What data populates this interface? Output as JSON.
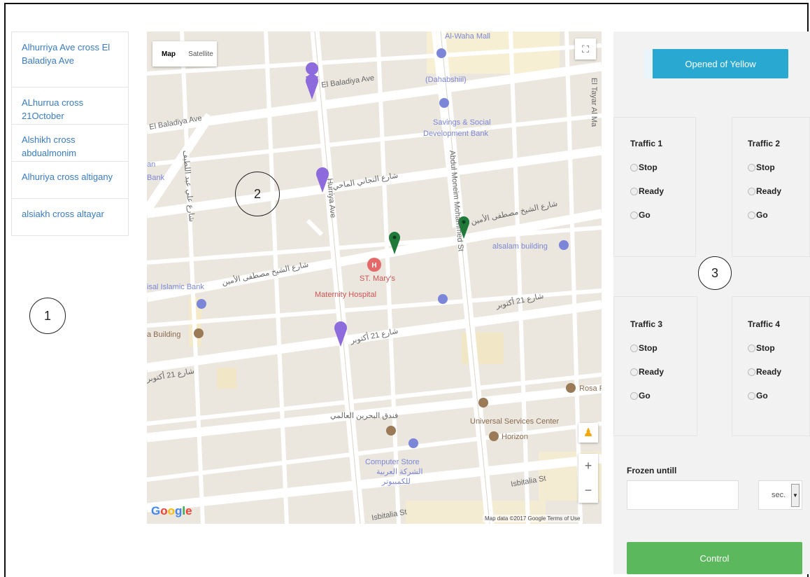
{
  "intersections": [
    {
      "label": "Alhurriya Ave cross El Baladiya Ave"
    },
    {
      "label": "ALhurrua cross 21October"
    },
    {
      "label": "Alshikh cross abdualmonim"
    },
    {
      "label": "Alhuriya cross altigany"
    },
    {
      "label": "alsiakh cross altayar"
    }
  ],
  "annotations": {
    "left": "1",
    "map": "2",
    "panel": "3"
  },
  "map": {
    "type_map": "Map",
    "type_satellite": "Satellite",
    "google": "Google",
    "attribution": "Map data ©2017 Google   Terms of Use",
    "labels": {
      "baladiya_1": "El Baladiya Ave",
      "baladiya_2": "El Baladiya Ave",
      "wadi_mall": "Al-Waha Mall",
      "dahabshil": "(Dahabshiil)",
      "savings_1": "Savings & Social",
      "savings_2": "Development Bank",
      "tayar": "El Tayar Al Ma",
      "bank_1": "an",
      "bank_2": "Bank",
      "salam": "alsalam building",
      "islamic_bank": "isal Islamic Bank",
      "stmary_1": "ST. Mary's",
      "stmary_2": "Maternity Hospital",
      "building": "a Building",
      "universal": "Universal Services Center",
      "horizon": "Horizon",
      "rosa": "Rosa F",
      "computer_1": "Computer Store",
      "computer_2": "الشركة العربية",
      "computer_3": "للكمبيوتر",
      "istabalia_1": "Isbitalia St",
      "istabalia_2": "Isbitalia St",
      "hurriya": "Hurriya Ave",
      "abdul": "Abdul Moneim Mohammed St",
      "ar_tigany": "شارع التجاني الماحي",
      "ar_shaikh_1": "شارع الشيخ مصطفى الأمين",
      "ar_shaikh_2": "شارع الشيخ مصطفى الأمين",
      "ar_21_1": "شارع 21 أكتوبر",
      "ar_21_2": "شارع 21 أكتوبر",
      "ar_21_3": "شارع 21 أكتوبر",
      "ar_hotel": "فندق البحرين العالمي",
      "ar_abdul": "شارع علي عبد اللطيف"
    }
  },
  "panel": {
    "mode_button": "Opened of Yellow",
    "lights": [
      {
        "name": "Traffic 1",
        "options": [
          "Stop",
          "Ready",
          "Go"
        ]
      },
      {
        "name": "Traffic 2",
        "options": [
          "Stop",
          "Ready",
          "Go"
        ]
      },
      {
        "name": "Traffic 3",
        "options": [
          "Stop",
          "Ready",
          "Go"
        ]
      },
      {
        "name": "Traffic 4",
        "options": [
          "Stop",
          "Ready",
          "Go"
        ]
      }
    ],
    "frozen_label": "Frozen untill",
    "frozen_value": "",
    "unit": "sec.",
    "control_button": "Control"
  },
  "colors": {
    "primary": "#29a9d2",
    "success": "#5cb85c",
    "link": "#3a7bbf",
    "pin_purple": "#8e6bdc",
    "pin_green": "#1f7a3a"
  }
}
